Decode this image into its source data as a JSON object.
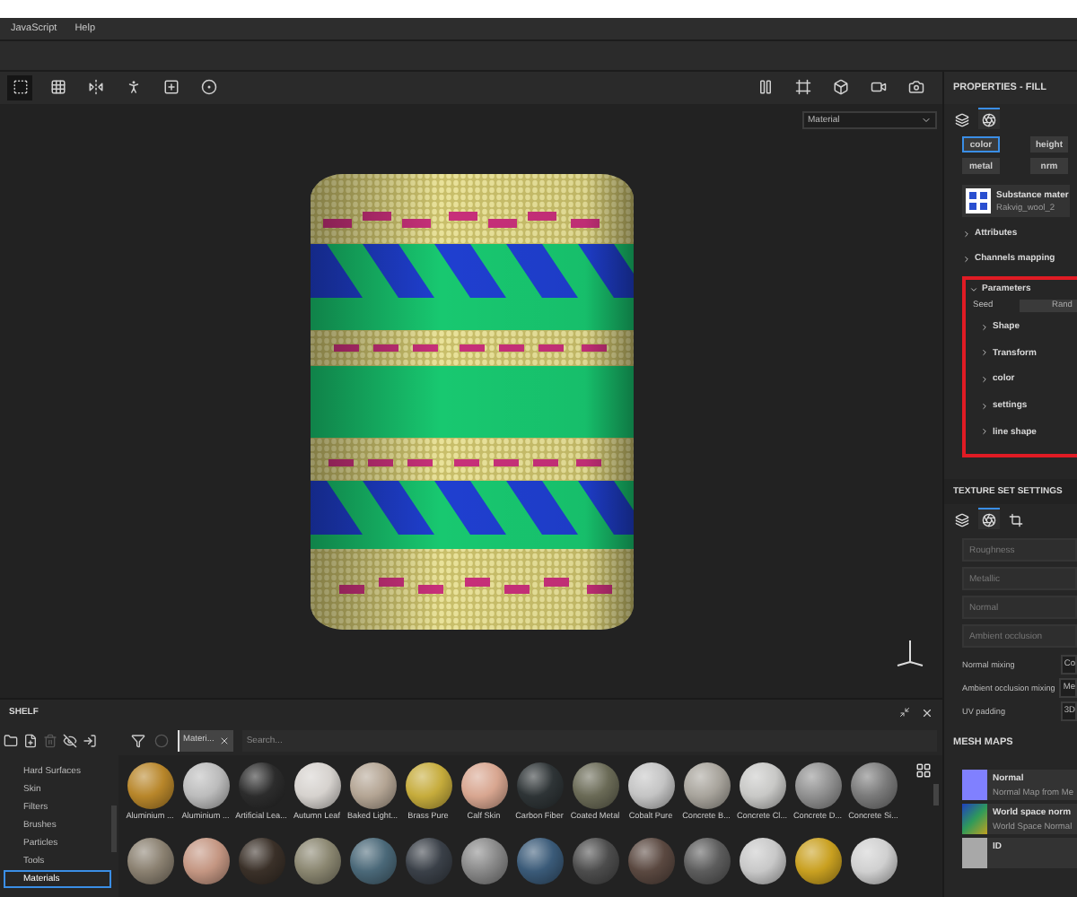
{
  "menu": [
    "JavaScript",
    "Help"
  ],
  "viewport_toolbar": {
    "tools": [
      {
        "selected": true
      },
      {
        "selected": false
      },
      {
        "selected": false
      },
      {
        "selected": false
      },
      {
        "selected": false
      },
      {
        "selected": false
      }
    ]
  },
  "viewport": {
    "display_select": "Material"
  },
  "properties": {
    "title": "PROPERTIES - FILL",
    "tabs": [
      {
        "selected": false
      },
      {
        "selected": true
      }
    ],
    "channels": [
      {
        "label": "color",
        "selected": true
      },
      {
        "label": "height",
        "selected": false
      },
      {
        "label": "metal",
        "selected": false
      },
      {
        "label": "nrm",
        "selected": false
      }
    ],
    "material": {
      "title": "Substance mater",
      "name": "Rakvig_wool_2"
    },
    "sections": [
      {
        "label": "Attributes",
        "expanded": false
      },
      {
        "label": "Channels mapping",
        "expanded": false
      }
    ],
    "parameters": {
      "label": "Parameters",
      "expanded": true,
      "seed_label": "Seed",
      "seed_button": "Rand",
      "groups": [
        {
          "label": "Shape",
          "expanded": false
        },
        {
          "label": "Transform",
          "expanded": false
        },
        {
          "label": "color",
          "expanded": false
        },
        {
          "label": "settings",
          "expanded": false
        },
        {
          "label": "line shape",
          "expanded": false
        }
      ]
    }
  },
  "texture_set_settings": {
    "title": "TEXTURE SET SETTINGS",
    "tabs": [
      {
        "selected": false
      },
      {
        "selected": true
      },
      {
        "selected": false
      }
    ],
    "channels": [
      "Roughness",
      "Metallic",
      "Normal",
      "Ambient occlusion"
    ],
    "settings": [
      {
        "label": "Normal mixing",
        "value": "Co"
      },
      {
        "label": "Ambient occlusion mixing",
        "value": "Me"
      },
      {
        "label": "UV padding",
        "value": "3D"
      }
    ]
  },
  "mesh_maps": {
    "title": "MESH MAPS",
    "maps": [
      {
        "name": "Normal",
        "source": "Normal Map from Me",
        "kind": "flat",
        "color": "#8080ff"
      },
      {
        "name": "World space norm",
        "source": "World Space Normal",
        "kind": "gradient",
        "color": "#2f9a5a"
      },
      {
        "name": "ID",
        "kind": "flat",
        "color": "#a8a8a8"
      }
    ]
  },
  "shelf": {
    "title": "SHELF",
    "filter_tag": "Materi...",
    "search_placeholder": "Search...",
    "categories": [
      {
        "label": "Hard Surfaces",
        "selected": false
      },
      {
        "label": "Skin",
        "selected": false
      },
      {
        "label": "Filters",
        "selected": false
      },
      {
        "label": "Brushes",
        "selected": false
      },
      {
        "label": "Particles",
        "selected": false
      },
      {
        "label": "Tools",
        "selected": false
      },
      {
        "label": "Materials",
        "selected": true
      }
    ],
    "materials": [
      {
        "label": "Aluminium ...",
        "color": "#b8862a"
      },
      {
        "label": "Aluminium ...",
        "color": "#bcbcbc"
      },
      {
        "label": "Artificial Lea...",
        "color": "#2c2c2c"
      },
      {
        "label": "Autumn Leaf",
        "color": "#d6d2ce"
      },
      {
        "label": "Baked Light...",
        "color": "#b4a594"
      },
      {
        "label": "Brass Pure",
        "color": "#c6ac3c"
      },
      {
        "label": "Calf Skin",
        "color": "#d8a690"
      },
      {
        "label": "Carbon Fiber",
        "color": "#2e3436"
      },
      {
        "label": "Coated Metal",
        "color": "#6a6a56"
      },
      {
        "label": "Cobalt Pure",
        "color": "#c4c4c4"
      },
      {
        "label": "Concrete B...",
        "color": "#a8a49c"
      },
      {
        "label": "Concrete Cl...",
        "color": "#c8c8c6"
      },
      {
        "label": "Concrete D...",
        "color": "#909090"
      },
      {
        "label": "Concrete Si...",
        "color": "#7a7a7a"
      }
    ],
    "materials_row_2": [
      {
        "color": "#8a8070"
      },
      {
        "color": "#c49682"
      },
      {
        "color": "#3a3028"
      },
      {
        "color": "#8a8670"
      },
      {
        "color": "#4a6878"
      },
      {
        "color": "#3a4048"
      },
      {
        "color": "#888888"
      },
      {
        "color": "#3a5a78"
      },
      {
        "color": "#4c4c4c"
      },
      {
        "color": "#5a4840"
      },
      {
        "color": "#5c5c5c"
      },
      {
        "color": "#c8c8c8"
      },
      {
        "color": "#c9a020"
      },
      {
        "color": "#d0d0d0"
      }
    ]
  }
}
